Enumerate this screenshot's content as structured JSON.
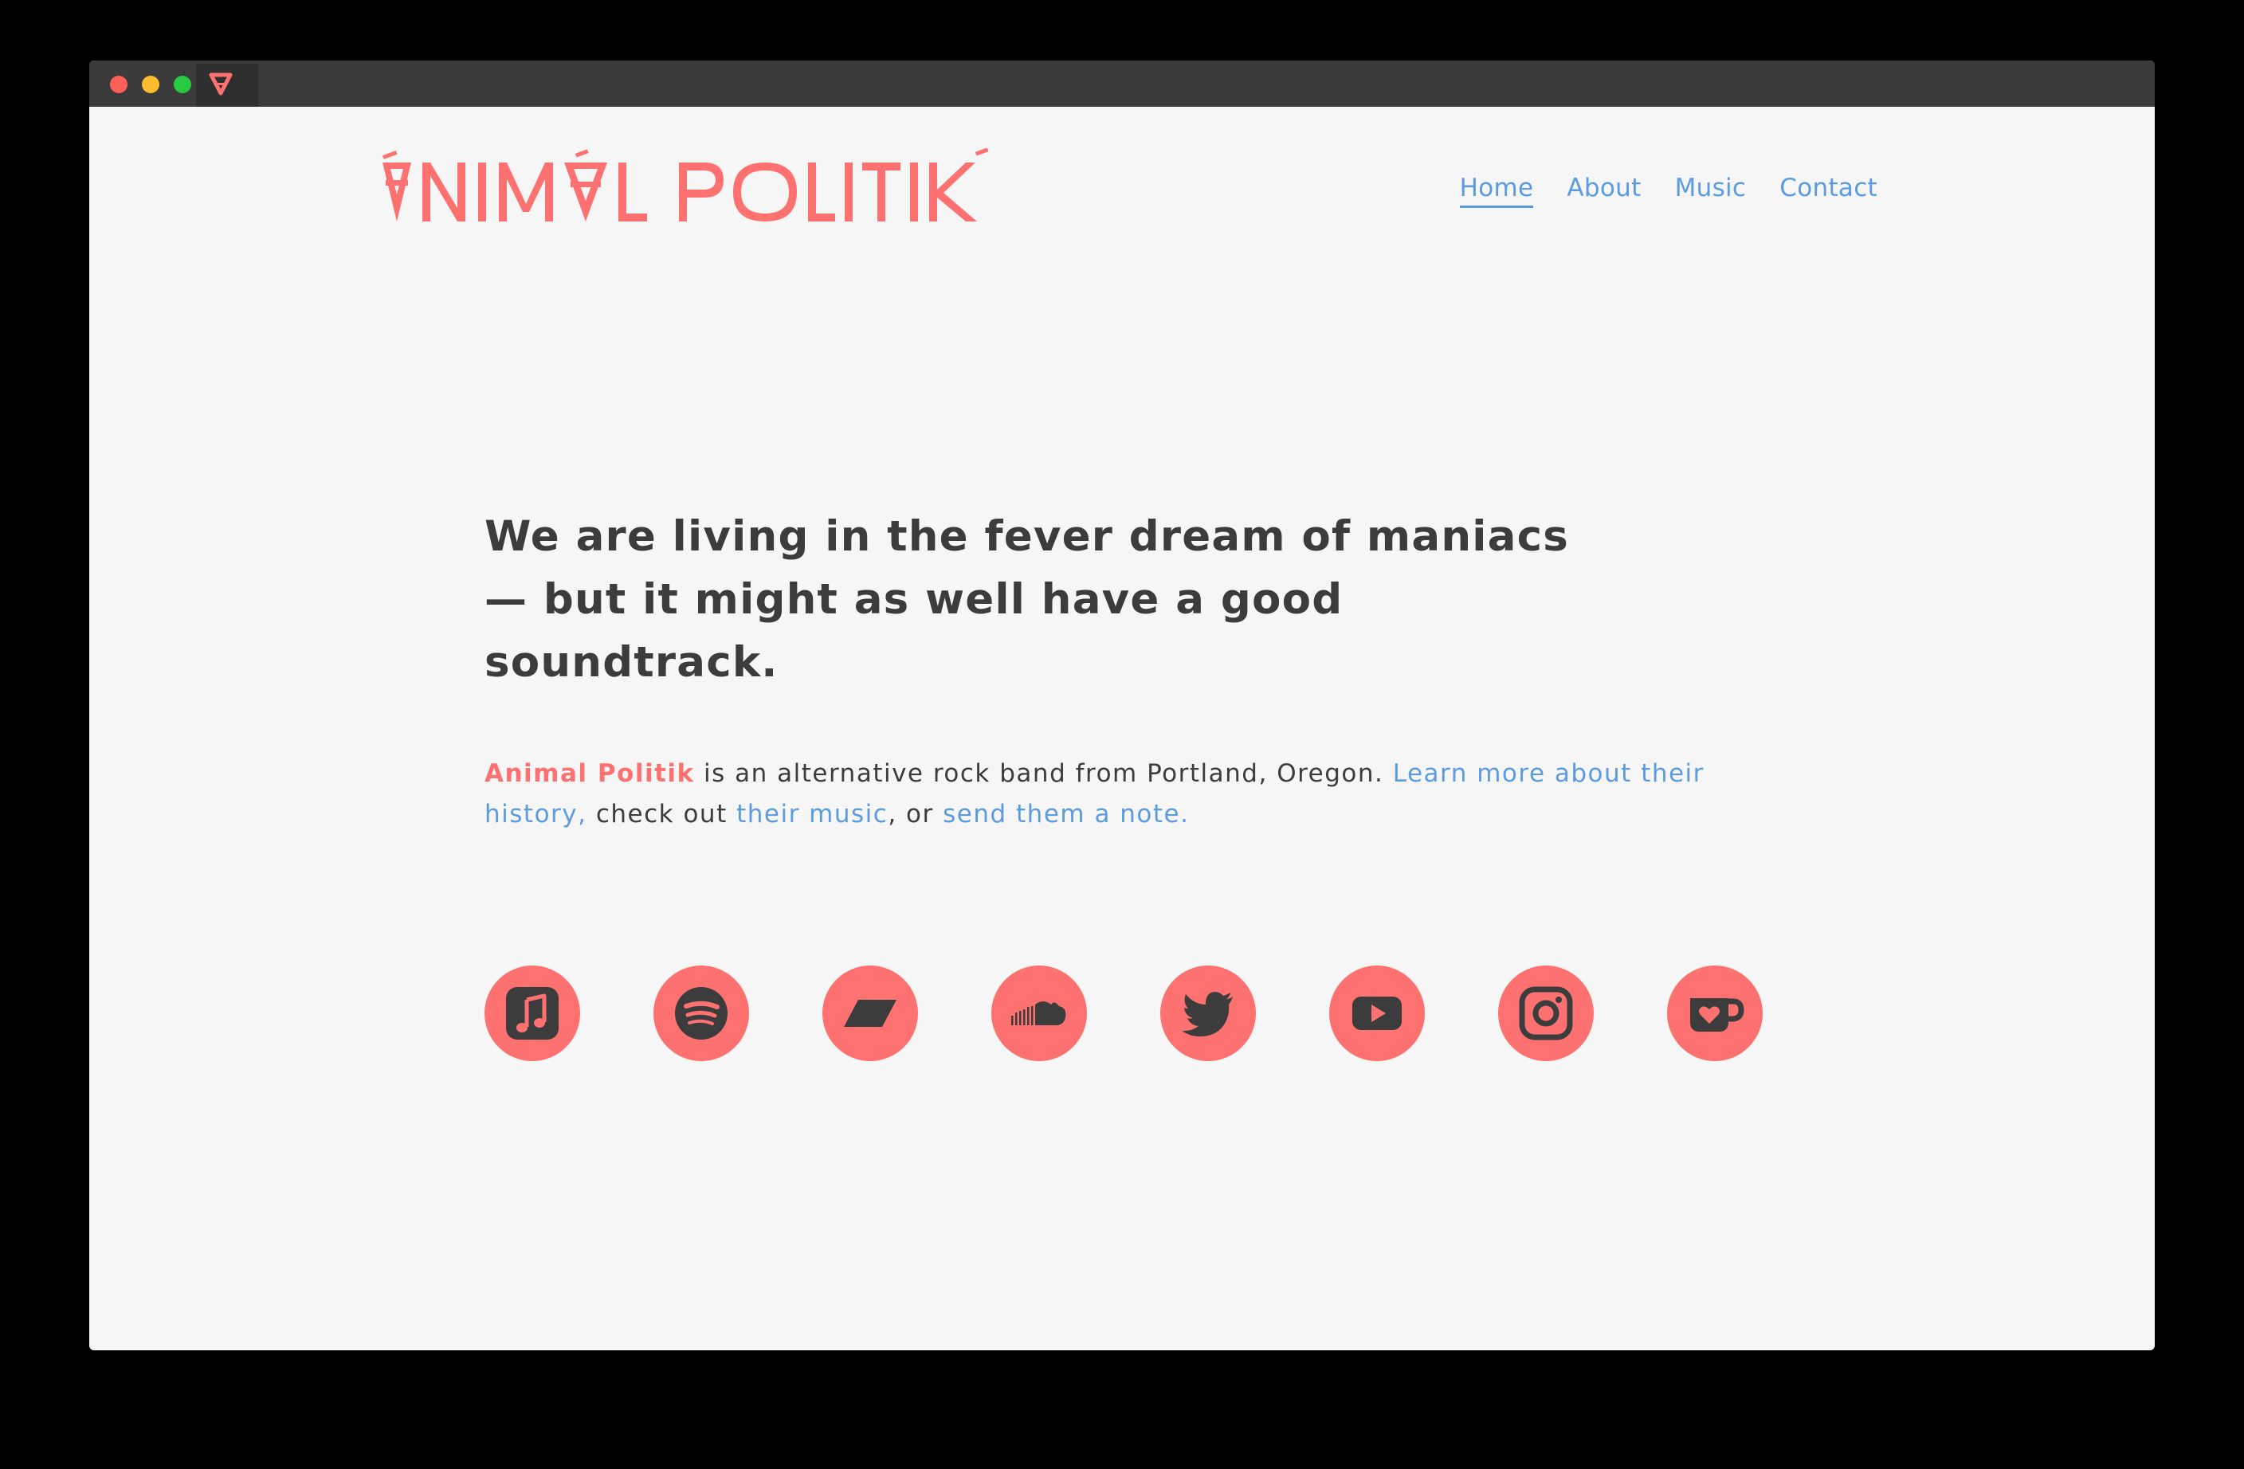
{
  "colors": {
    "accent": "#fd7271",
    "link": "#5b9bdf",
    "text": "#3c3c3c",
    "background": "#f6f6f6"
  },
  "logo": {
    "text": "ANIMAL POLITIK"
  },
  "nav": {
    "items": [
      {
        "label": "Home",
        "active": true
      },
      {
        "label": "About"
      },
      {
        "label": "Music"
      },
      {
        "label": "Contact"
      }
    ]
  },
  "hero": {
    "headline_lines": [
      "We are living in the fever dream of maniacs",
      "— but it might as well have a good",
      "soundtrack."
    ]
  },
  "intro": {
    "brand": "Animal Politik",
    "text_1": " is an alternative rock band from Portland, Oregon. ",
    "link_history": "Learn more about their history,",
    "text_2": " check out ",
    "link_music": "their music",
    "text_3": ", or ",
    "link_note": "send them a note."
  },
  "socials": [
    {
      "icon": "apple-music-icon"
    },
    {
      "icon": "spotify-icon"
    },
    {
      "icon": "bandcamp-icon"
    },
    {
      "icon": "soundcloud-icon"
    },
    {
      "icon": "twitter-icon"
    },
    {
      "icon": "youtube-icon"
    },
    {
      "icon": "instagram-icon"
    },
    {
      "icon": "kofi-icon"
    }
  ]
}
